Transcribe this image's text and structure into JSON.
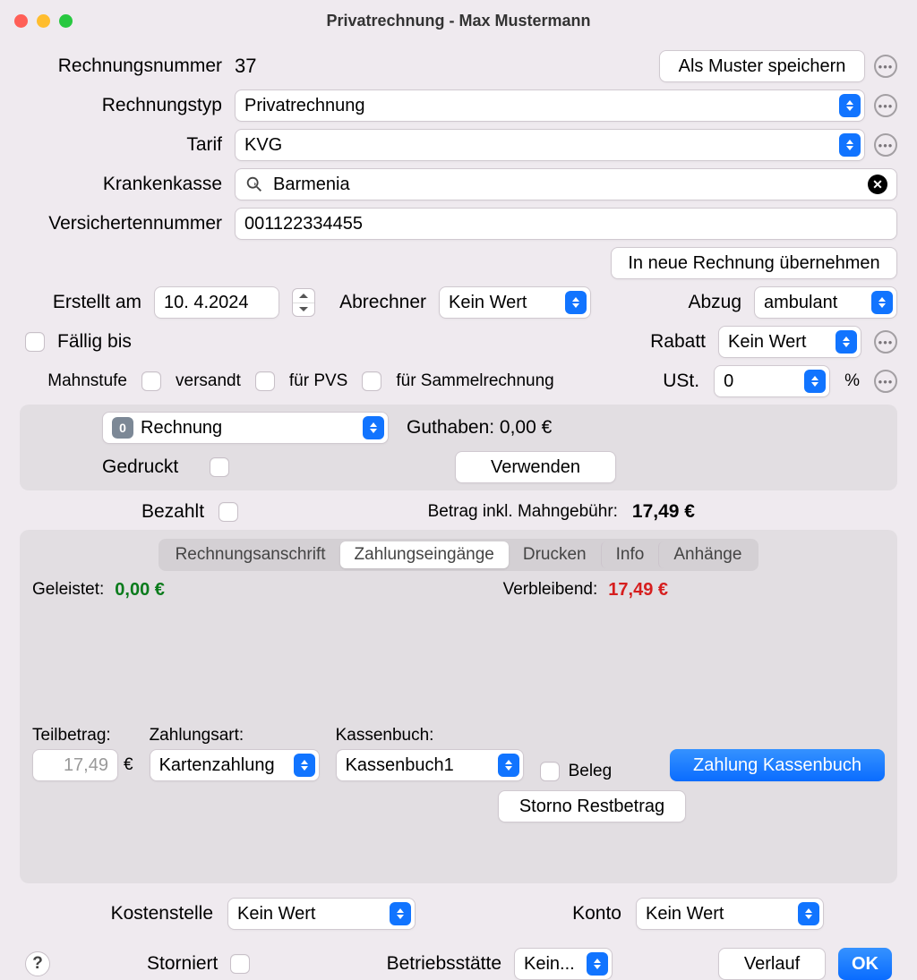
{
  "window": {
    "title": "Privatrechnung - Max Mustermann"
  },
  "labels": {
    "rechnungsnummer": "Rechnungsnummer",
    "rechnungstyp": "Rechnungstyp",
    "tarif": "Tarif",
    "krankenkasse": "Krankenkasse",
    "versichertennummer": "Versichertennummer",
    "erstellt_am": "Erstellt am",
    "abrechner": "Abrechner",
    "abzug": "Abzug",
    "faellig_bis": "Fällig bis",
    "rabatt": "Rabatt",
    "mahnstufe": "Mahnstufe",
    "ust": "USt.",
    "gedruckt": "Gedruckt",
    "guthaben": "Guthaben: 0,00 €",
    "bezahlt": "Bezahlt",
    "betrag_mg": "Betrag inkl. Mahngebühr:",
    "geleistet": "Geleistet:",
    "verbleibend": "Verbleibend:",
    "teilbetrag": "Teilbetrag:",
    "zahlungsart": "Zahlungsart:",
    "kassenbuch": "Kassenbuch:",
    "beleg": "Beleg",
    "kostenstelle": "Kostenstelle",
    "konto": "Konto",
    "storniert": "Storniert",
    "betriebsstaette": "Betriebsstätte",
    "percent": "%",
    "euro": "€"
  },
  "values": {
    "rechnungsnummer": "37",
    "rechnungstyp": "Privatrechnung",
    "tarif": "KVG",
    "krankenkasse": "Barmenia",
    "versichertennummer": "001122334455",
    "erstellt_am": "10.  4.2024",
    "abrechner": "Kein Wert",
    "abzug": "ambulant",
    "rabatt": "Kein Wert",
    "ust": "0",
    "dokument": "Rechnung",
    "betrag_mg": "17,49 €",
    "geleistet": "0,00 €",
    "verbleibend": "17,49 €",
    "teilbetrag": "17,49",
    "zahlungsart": "Kartenzahlung",
    "kassenbuch": "Kassenbuch1",
    "kostenstelle": "Kein Wert",
    "konto": "Kein Wert",
    "betriebsstaette": "Kein..."
  },
  "checkbox_labels": {
    "versandt": "versandt",
    "fuer_pvs": "für PVS",
    "fuer_sammel": "für Sammelrechnung"
  },
  "buttons": {
    "als_muster": "Als Muster speichern",
    "in_neue": "In neue Rechnung übernehmen",
    "verwenden": "Verwenden",
    "zahlung_kb": "Zahlung Kassenbuch",
    "storno_rest": "Storno Restbetrag",
    "verlauf": "Verlauf",
    "ok": "OK"
  },
  "tabs": [
    "Rechnungsanschrift",
    "Zahlungseingänge",
    "Drucken",
    "Info",
    "Anhänge"
  ]
}
